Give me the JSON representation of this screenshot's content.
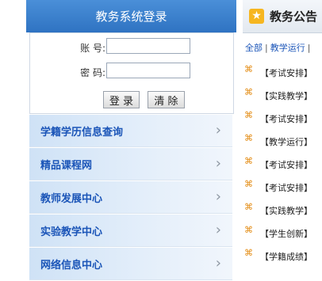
{
  "login": {
    "title": "教务系统登录",
    "account_label": "账 号:",
    "account_value": "",
    "password_label": "密 码:",
    "password_value": "",
    "login_button": "登 录",
    "clear_button": "清 除"
  },
  "menu": {
    "items": [
      {
        "label": "学籍学历信息查询"
      },
      {
        "label": "精品课程网"
      },
      {
        "label": "教师发展中心"
      },
      {
        "label": "实验教学中心"
      },
      {
        "label": "网络信息中心"
      }
    ],
    "chevron": "›"
  },
  "news": {
    "title": "教务公告",
    "filters": [
      "全部",
      "教学运行"
    ],
    "items": [
      {
        "category": "【考试安排】"
      },
      {
        "category": "【实践教学】"
      },
      {
        "category": "【考试安排】"
      },
      {
        "category": "【教学运行】"
      },
      {
        "category": "【考试安排】"
      },
      {
        "category": "【考试安排】"
      },
      {
        "category": "【实践教学】"
      },
      {
        "category": "【学生创新】"
      },
      {
        "category": "【学籍成绩】"
      }
    ]
  }
}
